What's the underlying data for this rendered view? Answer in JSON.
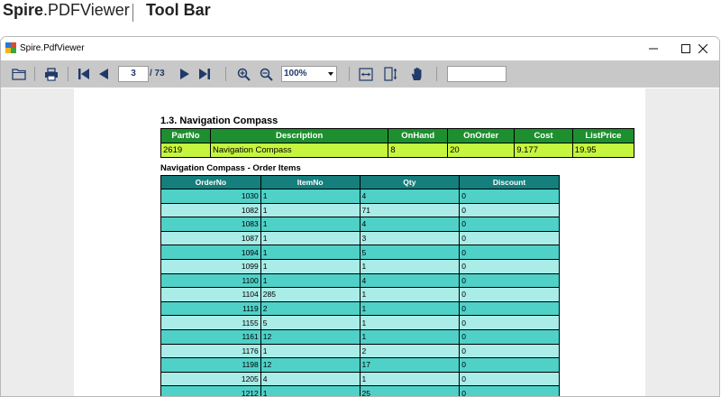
{
  "banner": {
    "brand_bold": "Spire",
    "brand_rest": ".PDFViewer",
    "subtitle": "Tool Bar"
  },
  "window": {
    "title": "Spire.PdfViewer"
  },
  "toolbar": {
    "current_page": "3",
    "total_pages": "/ 73",
    "zoom": "100%",
    "search_value": ""
  },
  "document": {
    "section_title": "1.3. Navigation Compass",
    "summary_headers": [
      "PartNo",
      "Description",
      "OnHand",
      "OnOrder",
      "Cost",
      "ListPrice"
    ],
    "summary_row": [
      "2619",
      "Navigation Compass",
      "8",
      "20",
      "9.177",
      "19.95"
    ],
    "items_title": "Navigation Compass - Order Items",
    "items_headers": [
      "OrderNo",
      "ItemNo",
      "Qty",
      "Discount"
    ],
    "items_rows": [
      [
        "1030",
        "1",
        "4",
        "0"
      ],
      [
        "1082",
        "1",
        "71",
        "0"
      ],
      [
        "1083",
        "1",
        "4",
        "0"
      ],
      [
        "1087",
        "1",
        "3",
        "0"
      ],
      [
        "1094",
        "1",
        "5",
        "0"
      ],
      [
        "1099",
        "1",
        "1",
        "0"
      ],
      [
        "1100",
        "1",
        "4",
        "0"
      ],
      [
        "1104",
        "285",
        "1",
        "0"
      ],
      [
        "1119",
        "2",
        "1",
        "0"
      ],
      [
        "1155",
        "5",
        "1",
        "0"
      ],
      [
        "1161",
        "12",
        "1",
        "0"
      ],
      [
        "1176",
        "1",
        "2",
        "0"
      ],
      [
        "1198",
        "12",
        "17",
        "0"
      ],
      [
        "1205",
        "4",
        "1",
        "0"
      ],
      [
        "1212",
        "1",
        "25",
        "0"
      ]
    ]
  },
  "colors": {
    "summary_header": "#1e8f2f",
    "summary_row": "#c6f53f",
    "items_header": "#147f7c",
    "items_row_dark": "#4fd1c8",
    "items_row_light": "#aaece7",
    "toolbar_bg": "#c8c8c8",
    "icon_navy": "#1f3a6b"
  }
}
